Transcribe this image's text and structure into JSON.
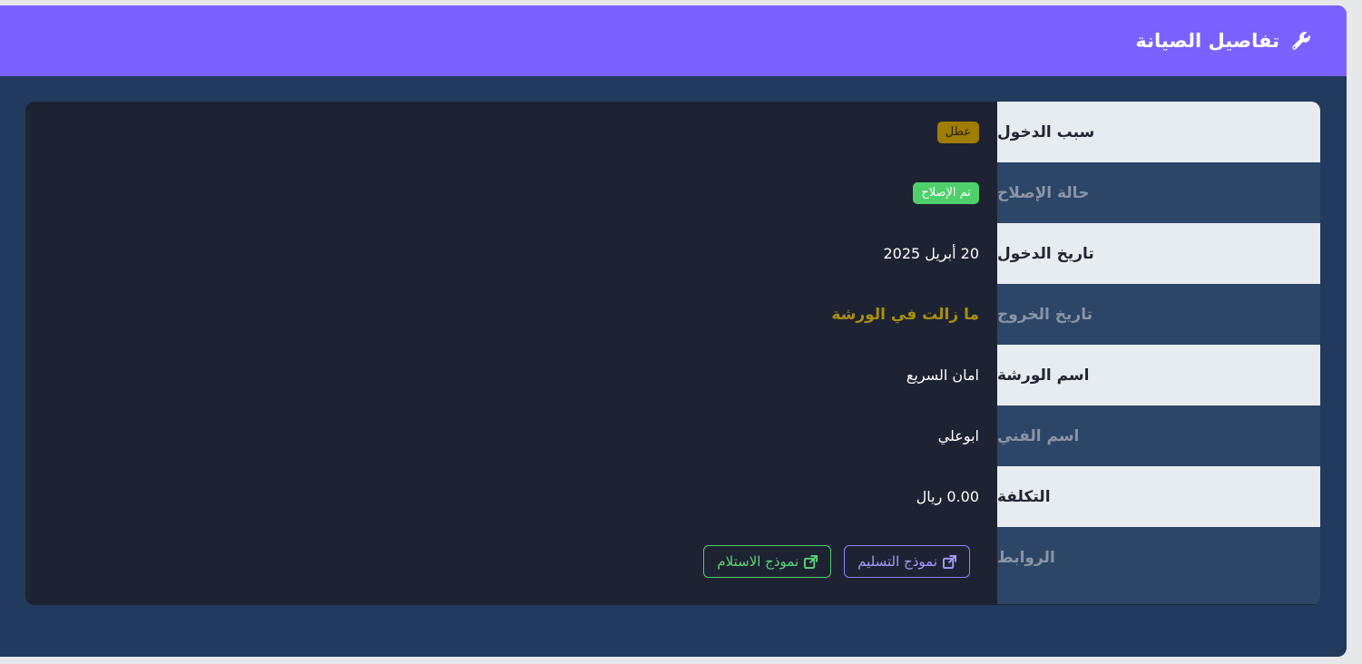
{
  "header": {
    "title": "تفاصيل الصيانة",
    "icon": "wrench-icon"
  },
  "rows": [
    {
      "label": "سبب الدخول",
      "value": "عطل"
    },
    {
      "label": "حالة الإصلاح",
      "value": "تم الإصلاح"
    },
    {
      "label": "تاريخ الدخول",
      "value": "20 أبريل 2025"
    },
    {
      "label": "تاريخ الخروج",
      "value": "ما زالت في الورشة"
    },
    {
      "label": "اسم الورشة",
      "value": "امان السريع"
    },
    {
      "label": "اسم الفني",
      "value": "ابوعلي"
    },
    {
      "label": "التكلفة",
      "value": "0.00 ريال"
    },
    {
      "label": "الروابط"
    }
  ],
  "links": {
    "delivery_label": "نموذج التسليم",
    "receipt_label": "نموذج الاستلام"
  },
  "colors": {
    "header": "#7b61ff",
    "card": "#213a5d",
    "panel": "#1e2333",
    "fault_badge": "#9e7d00",
    "repaired_badge": "#4fd06a",
    "pending_text": "#a88f0d"
  }
}
